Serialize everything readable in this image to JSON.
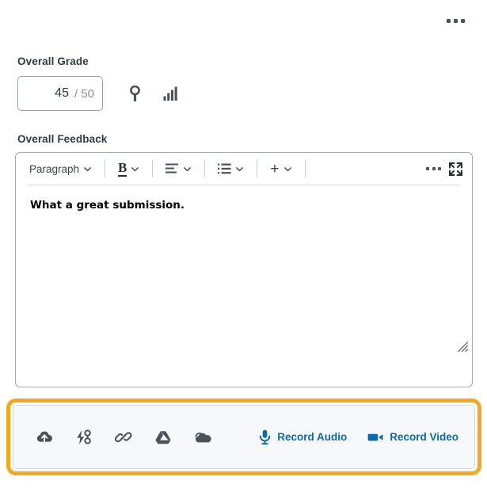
{
  "header": {
    "menu_icon": "kebab-menu-icon"
  },
  "grade": {
    "label": "Overall Grade",
    "value": "45",
    "out_of": "/ 50",
    "input_placeholder": "Grade",
    "rubric_icon": "rubric-key-icon",
    "statistics_icon": "grade-statistics-icon"
  },
  "feedback": {
    "label": "Overall Feedback",
    "body_text": "What a great submission.",
    "resize_handle": "resize-grip-icon"
  },
  "toolbar": {
    "paragraph_label": "Paragraph",
    "bold_label": "B",
    "plus_label": "+",
    "align_icon": "align-left-icon",
    "list_icon": "bulleted-list-icon",
    "caret_icon": "chevron-down-icon",
    "more_icon": "more-options-icon",
    "fullscreen_icon": "expand-fullscreen-icon"
  },
  "attachments": {
    "items": [
      {
        "name": "upload-cloud-icon",
        "title": "Upload File"
      },
      {
        "name": "quick-link-icon",
        "title": "Course Links"
      },
      {
        "name": "link-icon",
        "title": "Insert Link"
      },
      {
        "name": "google-drive-icon",
        "title": "Google Drive"
      },
      {
        "name": "onedrive-icon",
        "title": "OneDrive"
      }
    ],
    "record_audio_label": "Record Audio",
    "record_video_label": "Record Video",
    "microphone_icon": "microphone-icon",
    "video_icon": "video-camera-icon"
  },
  "colors": {
    "highlight": "#f5a81c",
    "link_blue": "#0a6ab0",
    "text_dark": "#2d3b45",
    "panel_bg": "#f7f8fb"
  }
}
